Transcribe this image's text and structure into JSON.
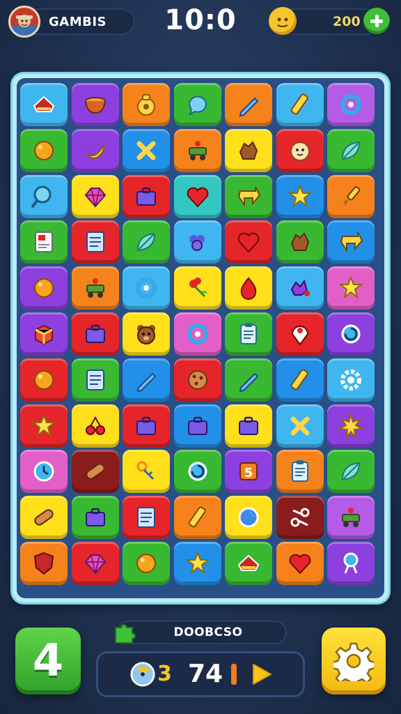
{
  "header": {
    "player_name": "GAMBIS",
    "timer": "10:0",
    "coins": "200"
  },
  "footer": {
    "level": "4",
    "code": "DOOBCSO",
    "moves": "3",
    "score": "74"
  },
  "board": {
    "rows": 11,
    "cols": 7,
    "tiles": [
      [
        "sky",
        "house"
      ],
      [
        "purple",
        "bowl"
      ],
      [
        "orange",
        "bag"
      ],
      [
        "green",
        "bubble"
      ],
      [
        "orange",
        "pencil"
      ],
      [
        "sky",
        "marker"
      ],
      [
        "violet",
        "ring"
      ],
      [
        "green",
        "ball"
      ],
      [
        "purple",
        "banana"
      ],
      [
        "blue",
        "cross"
      ],
      [
        "orange",
        "cart"
      ],
      [
        "yellow",
        "blob"
      ],
      [
        "red",
        "face"
      ],
      [
        "green",
        "leaf"
      ],
      [
        "sky",
        "lens"
      ],
      [
        "yellow",
        "gem"
      ],
      [
        "red",
        "case"
      ],
      [
        "teal",
        "heart"
      ],
      [
        "green",
        "arrow"
      ],
      [
        "blue",
        "star"
      ],
      [
        "orange",
        "brush"
      ],
      [
        "green",
        "card"
      ],
      [
        "red",
        "note"
      ],
      [
        "green",
        "leaf"
      ],
      [
        "sky",
        "grapes"
      ],
      [
        "red",
        "heart"
      ],
      [
        "green",
        "blob"
      ],
      [
        "blue",
        "arrow"
      ],
      [
        "purple",
        "ball"
      ],
      [
        "orange",
        "cart"
      ],
      [
        "sky",
        "ring"
      ],
      [
        "yellow",
        "flower"
      ],
      [
        "yellow",
        "drop"
      ],
      [
        "sky",
        "splash"
      ],
      [
        "pink",
        "star"
      ],
      [
        "purple",
        "cube"
      ],
      [
        "red",
        "case"
      ],
      [
        "yellow",
        "bear"
      ],
      [
        "pink",
        "ring"
      ],
      [
        "green",
        "clipboard"
      ],
      [
        "red",
        "pin"
      ],
      [
        "purple",
        "swirl"
      ],
      [
        "red",
        "ball"
      ],
      [
        "green",
        "note"
      ],
      [
        "blue",
        "pencil"
      ],
      [
        "red",
        "cookie"
      ],
      [
        "green",
        "pencil"
      ],
      [
        "blue",
        "marker"
      ],
      [
        "sky",
        "gear"
      ],
      [
        "red",
        "star"
      ],
      [
        "yellow",
        "cherry"
      ],
      [
        "red",
        "case"
      ],
      [
        "blue",
        "case"
      ],
      [
        "yellow",
        "case"
      ],
      [
        "sky",
        "cross"
      ],
      [
        "purple",
        "sun"
      ],
      [
        "pink",
        "clock"
      ],
      [
        "maroon",
        "bandage"
      ],
      [
        "yellow",
        "keys"
      ],
      [
        "green",
        "swirl"
      ],
      [
        "purple",
        "five"
      ],
      [
        "orange",
        "clipboard"
      ],
      [
        "green",
        "leaf"
      ],
      [
        "yellow",
        "bandage"
      ],
      [
        "green",
        "case"
      ],
      [
        "red",
        "note"
      ],
      [
        "orange",
        "marker"
      ],
      [
        "yellow",
        "moon"
      ],
      [
        "maroon",
        "scissors"
      ],
      [
        "violet",
        "cart"
      ],
      [
        "orange",
        "shield"
      ],
      [
        "red",
        "gem"
      ],
      [
        "green",
        "ball"
      ],
      [
        "blue",
        "star"
      ],
      [
        "green",
        "house"
      ],
      [
        "orange",
        "heart"
      ],
      [
        "purple",
        "bulb"
      ]
    ]
  },
  "colors": {
    "sky": "#3fb6ef",
    "blue": "#2290e8",
    "purple": "#8e3fe0",
    "violet": "#b45be8",
    "pink": "#e25fc8",
    "red": "#e5252a",
    "maroon": "#8b1c1c",
    "orange": "#f6821b",
    "yellow": "#ffe01a",
    "green": "#39b832",
    "teal": "#34c7c2"
  }
}
